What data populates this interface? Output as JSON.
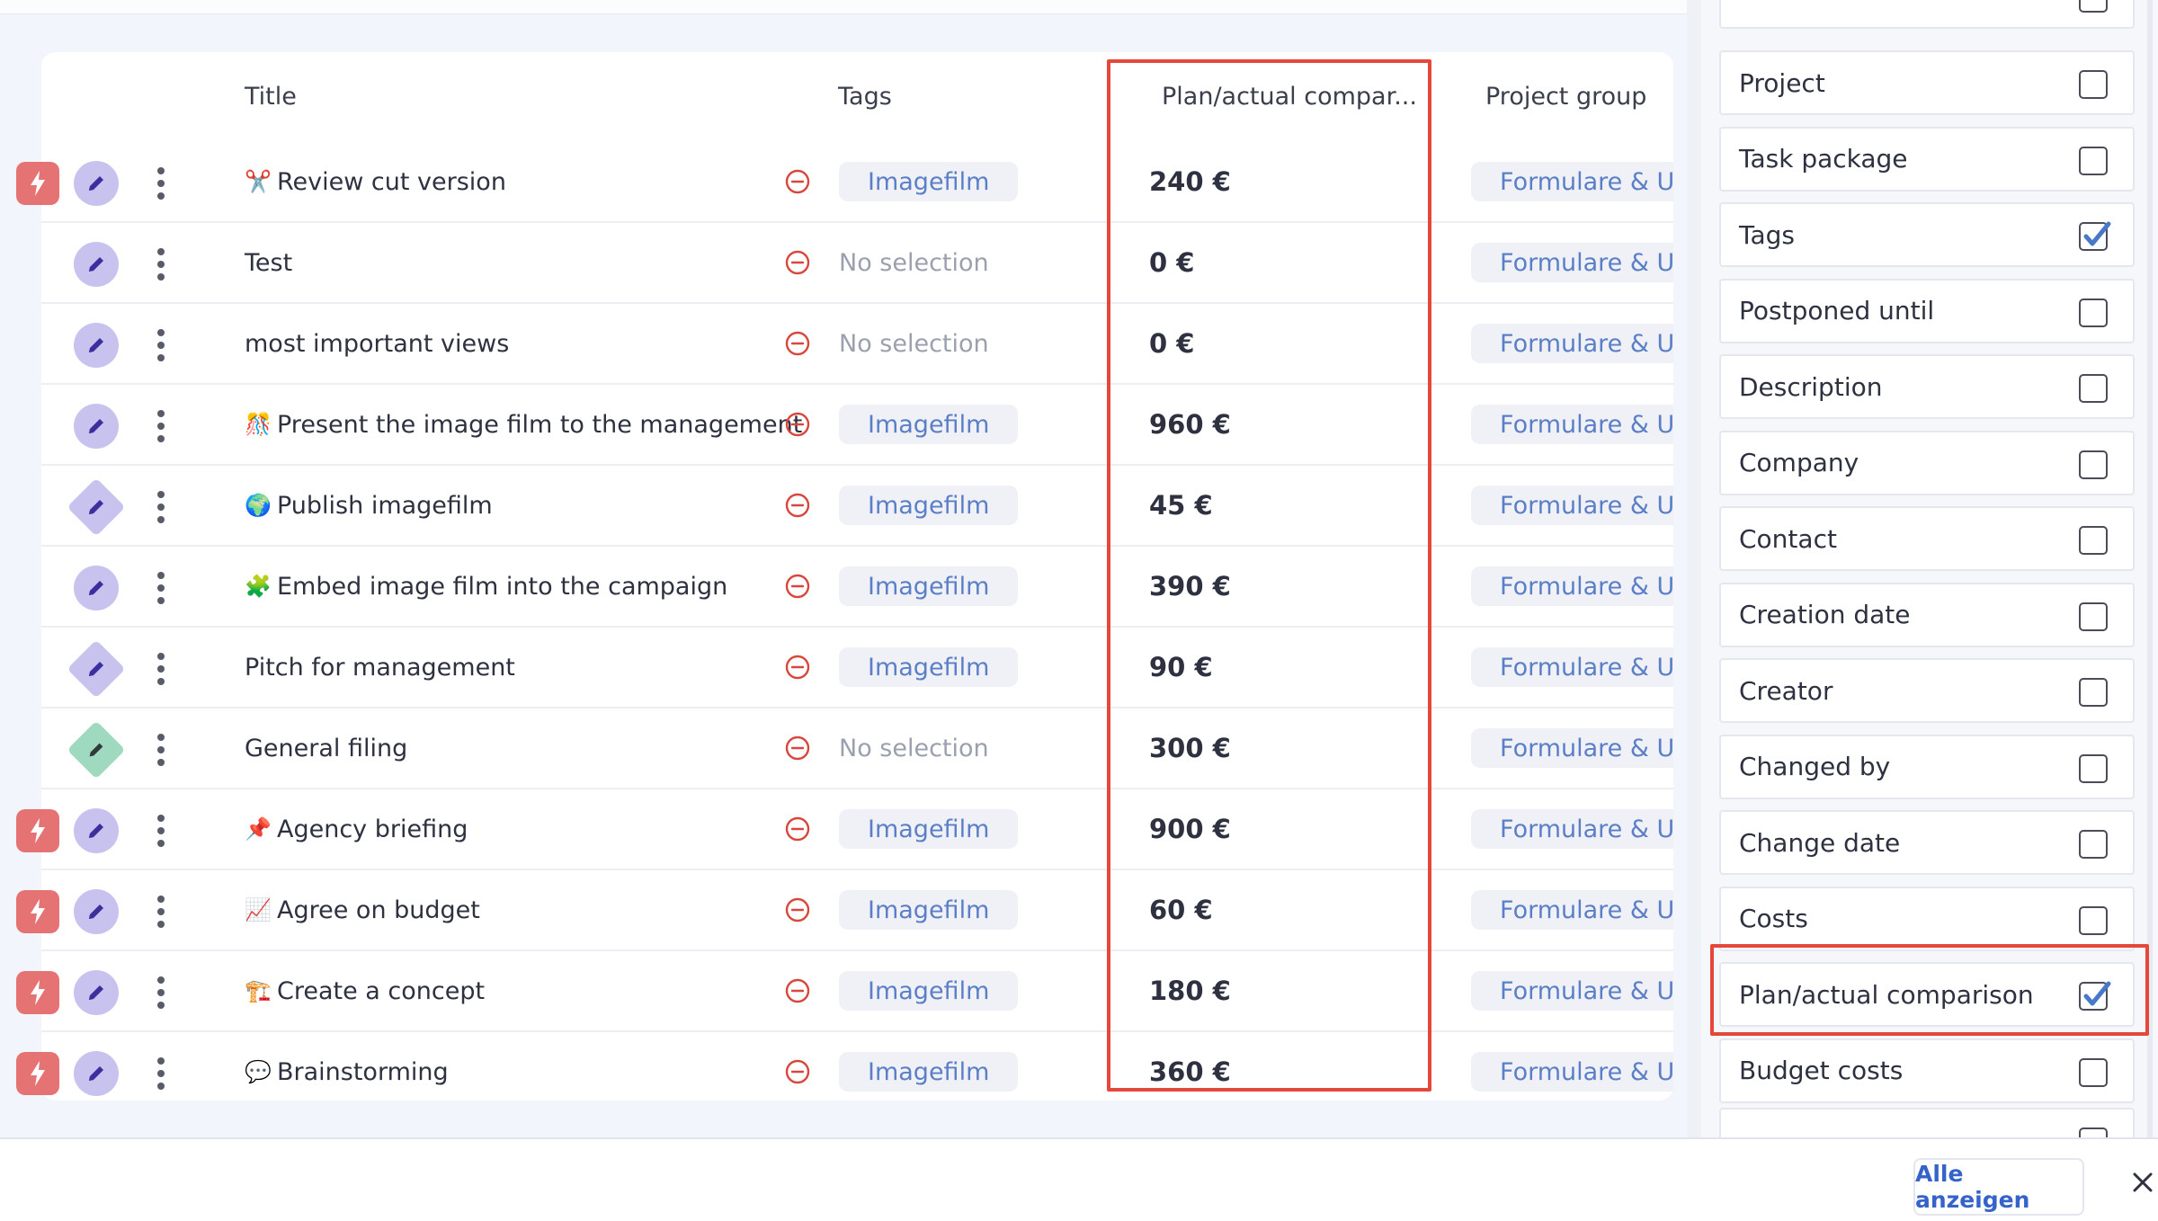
{
  "table": {
    "headers": {
      "title": "Title",
      "tags": "Tags",
      "plan_actual": "Plan/actual compar...",
      "project_group": "Project group"
    },
    "rows": [
      {
        "flash": true,
        "type": "circle",
        "emoji": "✂️",
        "title": "Review cut version",
        "tag": "Imagefilm",
        "tag_empty": false,
        "plan_value": "240",
        "currency": "€",
        "group": "Formulare & Up"
      },
      {
        "flash": false,
        "type": "circle",
        "emoji": "",
        "title": "Test",
        "tag": "No selection",
        "tag_empty": true,
        "plan_value": "0",
        "currency": "€",
        "group": "Formulare & Up"
      },
      {
        "flash": false,
        "type": "circle",
        "emoji": "",
        "title": "most important views",
        "tag": "No selection",
        "tag_empty": true,
        "plan_value": "0",
        "currency": "€",
        "group": "Formulare & Up"
      },
      {
        "flash": false,
        "type": "circle",
        "emoji": "🎊",
        "title": "Present the image film to the management",
        "tag": "Imagefilm",
        "tag_empty": false,
        "plan_value": "960",
        "currency": "€",
        "group": "Formulare & Up"
      },
      {
        "flash": false,
        "type": "diamond",
        "emoji": "🌍",
        "title": "Publish imagefilm",
        "tag": "Imagefilm",
        "tag_empty": false,
        "plan_value": "45",
        "currency": "€",
        "group": "Formulare & Up"
      },
      {
        "flash": false,
        "type": "circle",
        "emoji": "🧩",
        "title": "Embed image film into the campaign",
        "tag": "Imagefilm",
        "tag_empty": false,
        "plan_value": "390",
        "currency": "€",
        "group": "Formulare & Up"
      },
      {
        "flash": false,
        "type": "diamond",
        "emoji": "",
        "title": "Pitch for management",
        "tag": "Imagefilm",
        "tag_empty": false,
        "plan_value": "90",
        "currency": "€",
        "group": "Formulare & Up"
      },
      {
        "flash": false,
        "type": "diamond-green",
        "emoji": "",
        "title": "General filing",
        "tag": "No selection",
        "tag_empty": true,
        "plan_value": "300",
        "currency": "€",
        "group": "Formulare & Up"
      },
      {
        "flash": true,
        "type": "circle",
        "emoji": "📌",
        "title": "Agency briefing",
        "tag": "Imagefilm",
        "tag_empty": false,
        "plan_value": "900",
        "currency": "€",
        "group": "Formulare & Up"
      },
      {
        "flash": true,
        "type": "circle",
        "emoji": "📈",
        "title": "Agree on budget",
        "tag": "Imagefilm",
        "tag_empty": false,
        "plan_value": "60",
        "currency": "€",
        "group": "Formulare & Up"
      },
      {
        "flash": true,
        "type": "circle",
        "emoji": "🏗️",
        "title": "Create a concept",
        "tag": "Imagefilm",
        "tag_empty": false,
        "plan_value": "180",
        "currency": "€",
        "group": "Formulare & Up"
      },
      {
        "flash": true,
        "type": "circle",
        "emoji": "💬",
        "title": "Brainstorming",
        "tag": "Imagefilm",
        "tag_empty": false,
        "plan_value": "360",
        "currency": "€",
        "group": "Formulare & Up"
      }
    ]
  },
  "column_options": [
    {
      "label": "Project",
      "checked": false
    },
    {
      "label": "Task package",
      "checked": false
    },
    {
      "label": "Tags",
      "checked": true
    },
    {
      "label": "Postponed until",
      "checked": false
    },
    {
      "label": "Description",
      "checked": false
    },
    {
      "label": "Company",
      "checked": false
    },
    {
      "label": "Contact",
      "checked": false
    },
    {
      "label": "Creation date",
      "checked": false
    },
    {
      "label": "Creator",
      "checked": false
    },
    {
      "label": "Changed by",
      "checked": false
    },
    {
      "label": "Change date",
      "checked": false
    },
    {
      "label": "Costs",
      "checked": false
    },
    {
      "label": "Plan/actual comparison",
      "checked": true
    },
    {
      "label": "Budget costs",
      "checked": false
    }
  ],
  "footer": {
    "show_all_label": "Alle anzeigen"
  },
  "colors": {
    "accent_blue": "#3563c9",
    "highlight_red": "#e5483a",
    "flash_red": "#e57373",
    "type_purple": "#c7c3ee",
    "type_green": "#9fdac0"
  }
}
